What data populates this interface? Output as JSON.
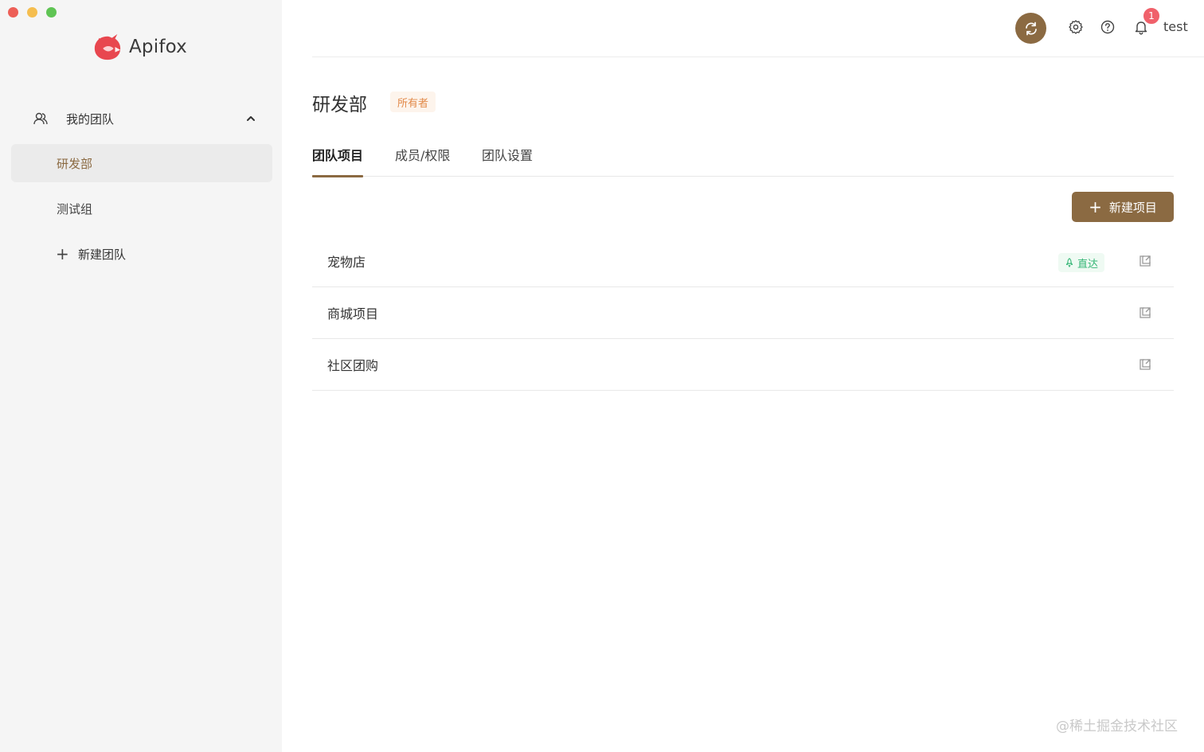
{
  "app": {
    "name": "Apifox",
    "brand_color": "#8b6a42",
    "logo_color": "#e8474f"
  },
  "sidebar": {
    "section_label": "我的团队",
    "teams": [
      {
        "label": "研发部",
        "active": true
      },
      {
        "label": "测试组",
        "active": false
      }
    ],
    "new_team_label": "新建团队"
  },
  "topbar": {
    "icons": [
      "sync-icon",
      "gear-icon",
      "help-icon",
      "bell-icon"
    ],
    "notification_count": "1",
    "username": "test"
  },
  "main": {
    "title": "研发部",
    "role_tag": "所有者",
    "tabs": [
      {
        "label": "团队项目",
        "active": true
      },
      {
        "label": "成员/权限",
        "active": false
      },
      {
        "label": "团队设置",
        "active": false
      }
    ],
    "new_project_label": "新建项目",
    "projects": [
      {
        "name": "宠物店",
        "tag": "直达"
      },
      {
        "name": "商城项目",
        "tag": ""
      },
      {
        "name": "社区团购",
        "tag": ""
      }
    ]
  },
  "watermark": "@稀土掘金技术社区"
}
